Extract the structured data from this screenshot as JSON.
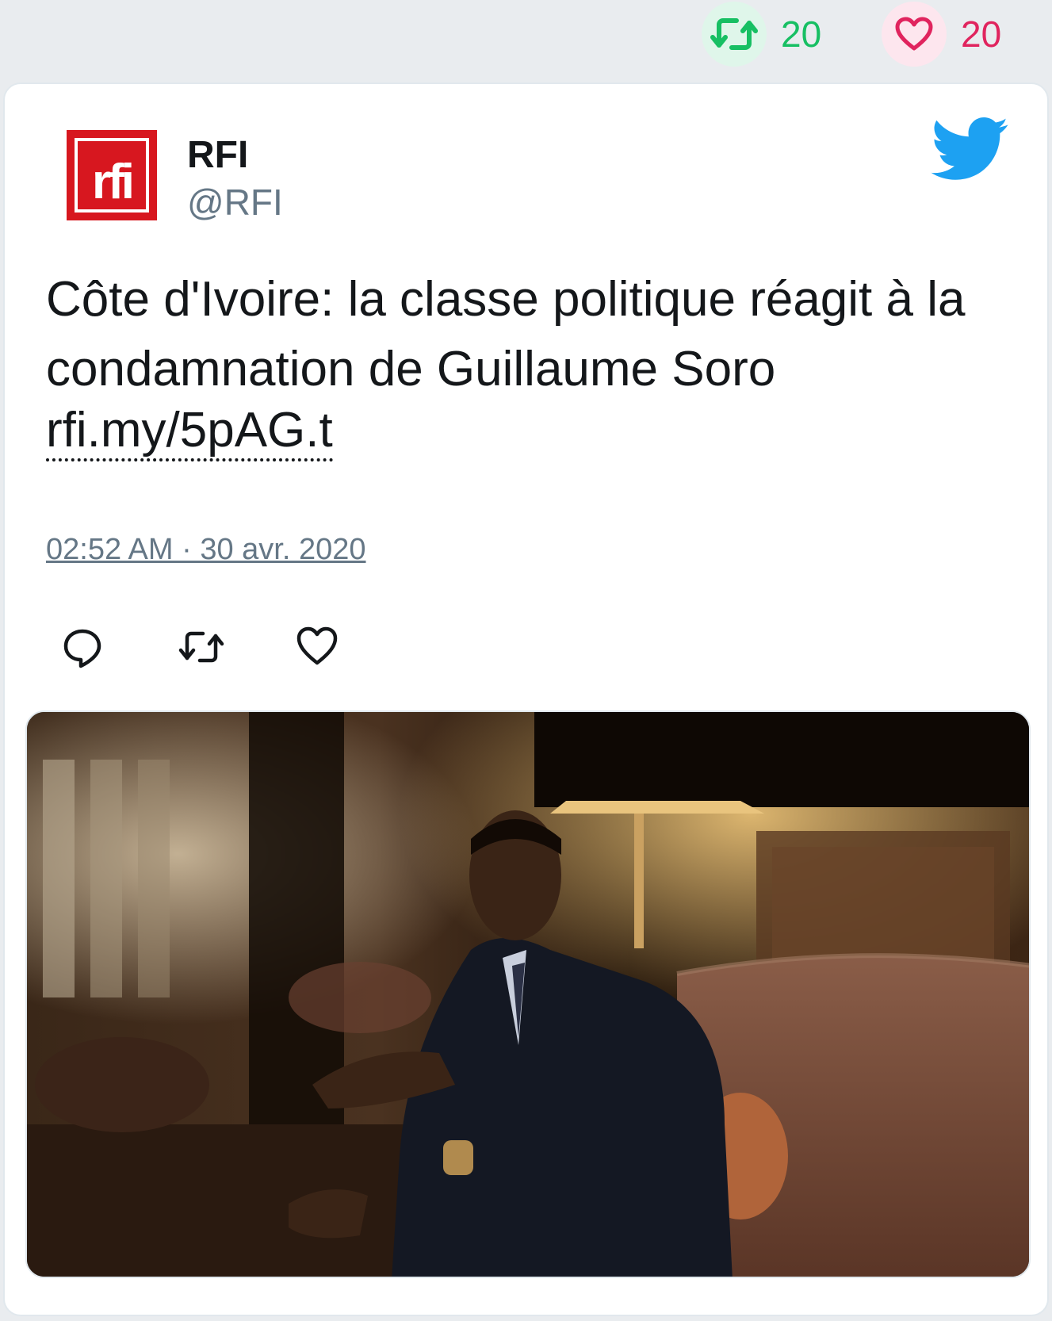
{
  "top_stats": {
    "retweets": "20",
    "likes": "20"
  },
  "tweet": {
    "author_name": "RFI",
    "author_handle": "@RFI",
    "avatar_text": "rfi",
    "text": "Côte d'Ivoire: la classe politique réagit à la condamnation de Guillaume Soro",
    "link": "rfi.my/5pAG.t",
    "timestamp": "02:52 AM · 30 avr. 2020"
  },
  "icons": {
    "retweet": "retweet-icon",
    "like": "heart-icon",
    "reply": "reply-icon",
    "twitter": "twitter-bird-icon"
  },
  "colors": {
    "retweet_green": "#17bf63",
    "like_red": "#e0245e",
    "twitter_blue": "#1da1f2",
    "rfi_red": "#d7171f"
  }
}
